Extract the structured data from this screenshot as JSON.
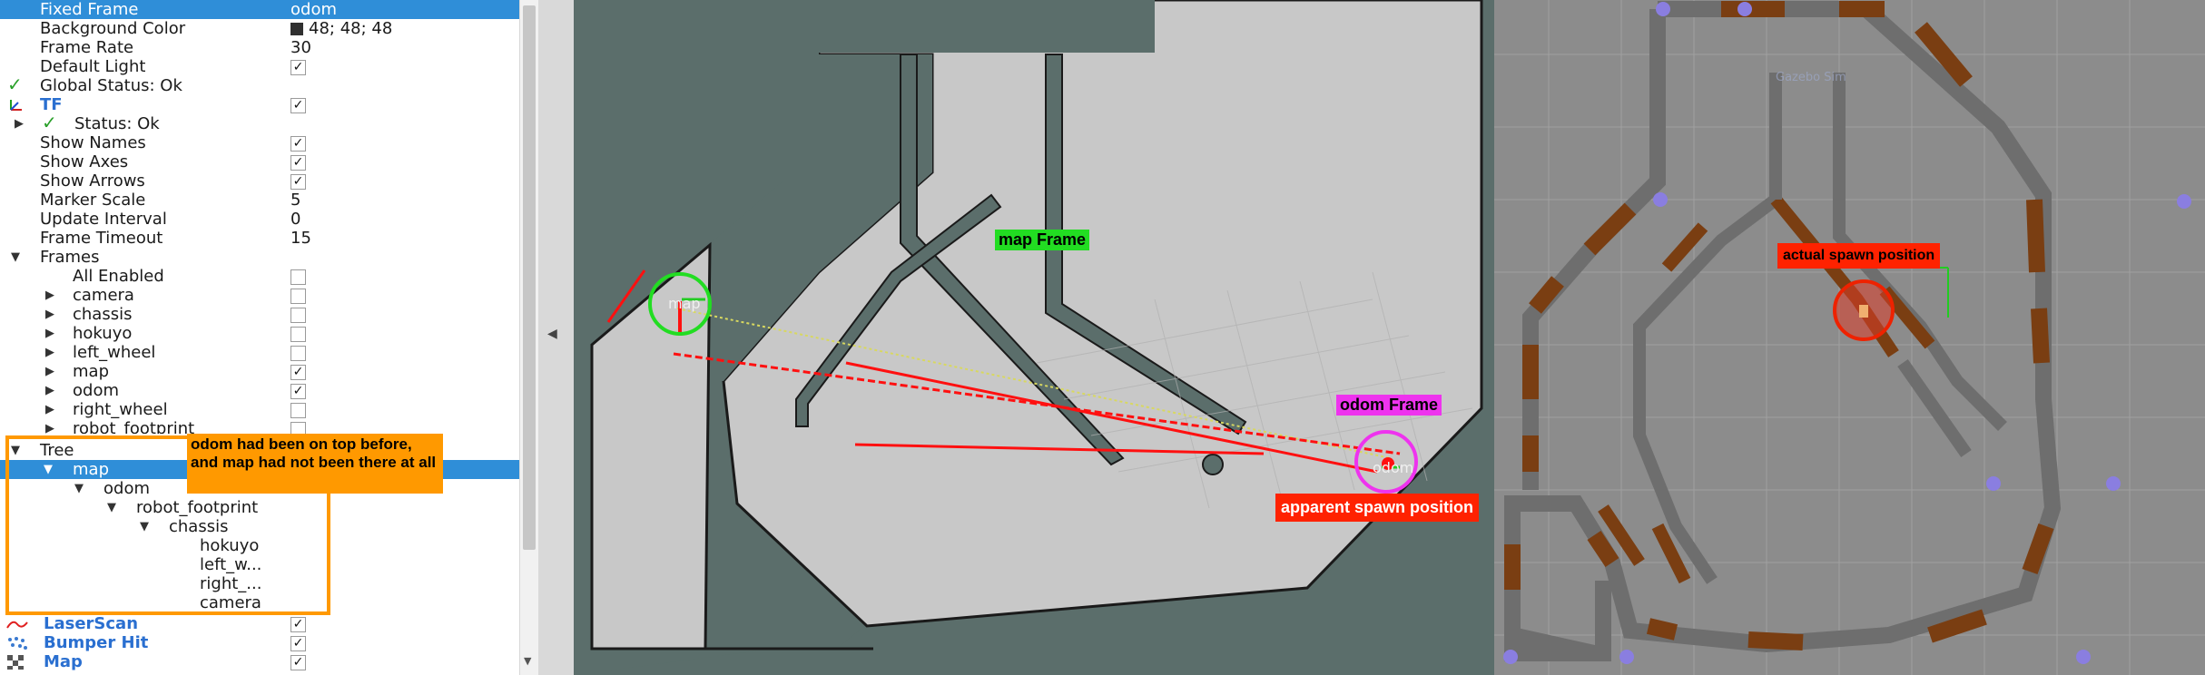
{
  "colors": {
    "selection": "#2f8ed8",
    "map_free": "#c8c8c8",
    "map_bg": "#5b6e6b",
    "label_green": "#22dd22",
    "label_magenta": "#ee33ee",
    "label_red": "#ff2200",
    "label_orange": "#ff9900",
    "gazebo_brown": "#7a3e12"
  },
  "panel": {
    "fixed_frame": {
      "label": "Fixed Frame",
      "value": "odom"
    },
    "background_color": {
      "label": "Background Color",
      "value": "48; 48; 48"
    },
    "frame_rate": {
      "label": "Frame Rate",
      "value": "30"
    },
    "default_light": {
      "label": "Default Light",
      "checked": true
    },
    "global_status": {
      "label": "Global Status: Ok"
    },
    "tf": {
      "label": "TF",
      "checked": true,
      "icon": "tf-icon"
    },
    "status": {
      "label": "Status: Ok"
    },
    "show_names": {
      "label": "Show Names",
      "checked": true
    },
    "show_axes": {
      "label": "Show Axes",
      "checked": true
    },
    "show_arrows": {
      "label": "Show Arrows",
      "checked": true
    },
    "marker_scale": {
      "label": "Marker Scale",
      "value": "5"
    },
    "update_interval": {
      "label": "Update Interval",
      "value": "0"
    },
    "frame_timeout": {
      "label": "Frame Timeout",
      "value": "15"
    },
    "frames": {
      "label": "Frames"
    },
    "all_enabled": {
      "label": "All Enabled",
      "checked": false
    },
    "frame_items": [
      {
        "label": "camera",
        "checked": false
      },
      {
        "label": "chassis",
        "checked": false
      },
      {
        "label": "hokuyo",
        "checked": false
      },
      {
        "label": "left_wheel",
        "checked": false
      },
      {
        "label": "map",
        "checked": true
      },
      {
        "label": "odom",
        "checked": true
      },
      {
        "label": "right_wheel",
        "checked": false
      },
      {
        "label": "robot_footprint",
        "checked": false
      }
    ],
    "tree": {
      "label": "Tree"
    },
    "tree_items": [
      {
        "label": "map"
      },
      {
        "label": "odom"
      },
      {
        "label": "robot_footprint"
      },
      {
        "label": "chassis"
      },
      {
        "label": "hokuyo"
      },
      {
        "label": "left_w..."
      },
      {
        "label": "right_..."
      },
      {
        "label": "camera"
      }
    ],
    "laserscan": {
      "label": "LaserScan",
      "checked": true
    },
    "bumper_hit": {
      "label": "Bumper Hit",
      "checked": true
    },
    "map_display": {
      "label": "Map",
      "checked": true
    }
  },
  "annotations": {
    "orange_note": "odom had been on top before, and map had not been there at all",
    "map_frame": "map Frame",
    "odom_frame": "odom Frame",
    "apparent_spawn": "apparent spawn position",
    "actual_spawn": "actual spawn position"
  },
  "viewport": {
    "map_text": "map",
    "odom_text": "odom",
    "gazebo_watermark": "Gazebo Sim"
  }
}
